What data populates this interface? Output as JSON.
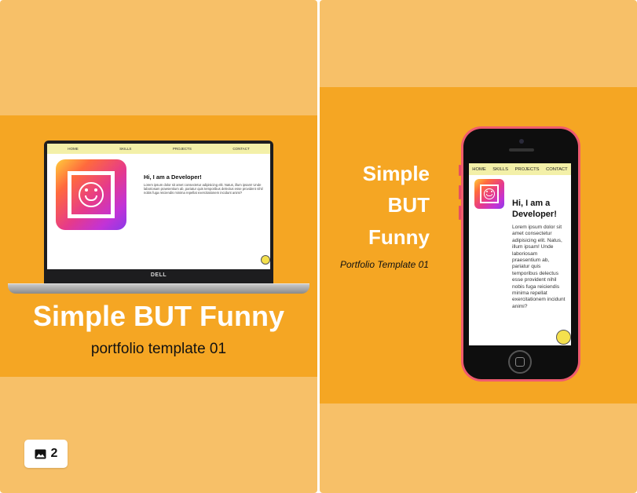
{
  "laptop_preview": {
    "nav": [
      "HOME",
      "SKILLS",
      "PROJECTS",
      "CONTACT"
    ],
    "heading": "Hi, I am a Developer!",
    "body": "Lorem ipsum dolor sit amet consectetur adipisicing elit. Natus, illum ipsam! Unde laboriosam praesentium ab, pariatur quis temporibus delectus esse provident nihil nobis fuga reiciendis minima repellat exercitationem incidunt animi?",
    "brand": "DELL"
  },
  "left_card": {
    "title": "Simple BUT Funny",
    "subtitle": "portfolio template 01"
  },
  "badge": {
    "icon": "image-icon",
    "count": "2"
  },
  "right_card": {
    "title_lines": [
      "Simple",
      "BUT",
      "Funny"
    ],
    "caption": "Portfolio Template 01"
  },
  "phone_preview": {
    "nav": [
      "HOME",
      "SKILLS",
      "PROJECTS",
      "CONTACT"
    ],
    "heading": "Hi, I am a Developer!",
    "body": "Lorem ipsum dolor sit amet consectetur adipisicing elit. Natus, illum ipsam! Unde laboriosam praesentium ab, pariatur quis temporibus delectus esse provident nihil nobis fuga reiciendis minima repellat exercitationem incidunt animi?"
  },
  "colors": {
    "card_background": "#f7c068",
    "band_orange": "#f5a623",
    "nav_yellow": "#f3f0a8",
    "phone_pink": "#ef5b6e"
  }
}
